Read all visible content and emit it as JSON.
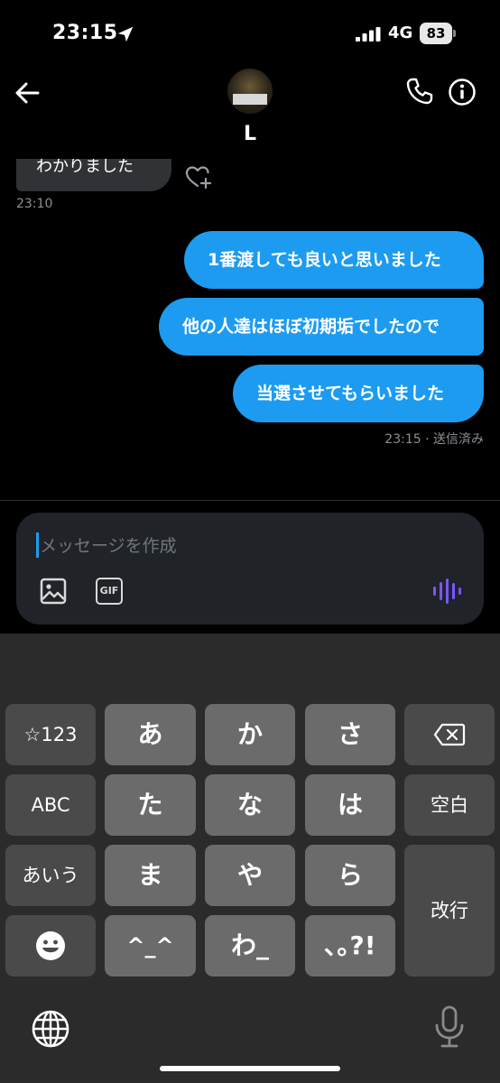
{
  "status_bar": {
    "time": "23:15",
    "network": "4G",
    "battery": "83"
  },
  "header": {
    "contact_name": "L"
  },
  "messages": {
    "incoming": {
      "text": "わかりました",
      "time": "23:10"
    },
    "outgoing": [
      {
        "text": "1番渡しても良いと思いました"
      },
      {
        "text": "他の人達はほぼ初期垢でしたので"
      },
      {
        "text": "当選させてもらいました"
      }
    ],
    "outgoing_status": "23:15 · 送信済み"
  },
  "composer": {
    "placeholder": "メッセージを作成",
    "gif_label": "GIF"
  },
  "keyboard": {
    "keys": {
      "symbols": "☆123",
      "a": "あ",
      "ka": "か",
      "sa": "さ",
      "abc": "ABC",
      "ta": "た",
      "na": "な",
      "ha": "は",
      "space": "空白",
      "kana": "あいう",
      "ma": "ま",
      "ya": "や",
      "ra": "ら",
      "enter": "改行",
      "kaomoji": "^_^",
      "wa": "わ_",
      "punct": "､｡?!"
    }
  },
  "colors": {
    "accent": "#1d9bf0",
    "incoming_bubble": "#2f3336",
    "voice": "#7856ff"
  }
}
